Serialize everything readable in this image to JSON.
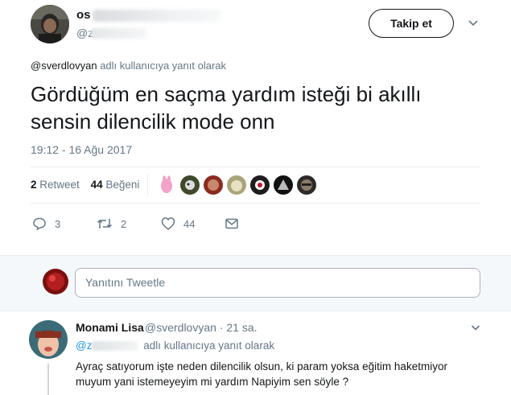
{
  "author": {
    "name_visible": "os",
    "handle_visible": "@z"
  },
  "follow_button": "Takip et",
  "reply_context": {
    "handle": "@sverdlovyan",
    "suffix": "adlı kullanıcıya yanıt olarak"
  },
  "tweet": {
    "text": "Gördüğüm en saçma yardım isteği bi akıllı sensin dilencilik mode onn",
    "timestamp": "19:12 - 16 Ağu 2017"
  },
  "stats": {
    "retweet_count": "2",
    "retweet_label": "Retweet",
    "like_count": "44",
    "like_label": "Beğeni"
  },
  "actions": {
    "reply_count": "3",
    "retweet_count": "2",
    "like_count": "44"
  },
  "composer": {
    "placeholder": "Yanıtını Tweetle"
  },
  "reply": {
    "name": "Monami Lisa",
    "handle": "@sverdlovyan",
    "separator": "·",
    "time": "21 sa.",
    "context_handle": "@z",
    "context_suffix": "adlı kullanıcıya yanıt olarak",
    "text": "Ayraç satıyorum işte neden dilencilik olsun, ki param yoksa eğitim haketmiyor muyum yani istemeyeyim mi yardım Napiyim sen söyle ?"
  },
  "colors": {
    "text": "#14171a",
    "muted": "#657786",
    "link": "#1b95e0",
    "divider": "#e6ecf0",
    "composer_bg": "#f5f8fa"
  },
  "icons": {
    "reply": "reply-icon",
    "retweet": "retweet-icon",
    "like": "heart-icon",
    "dm": "envelope-icon",
    "menu": "chevron-down-icon"
  }
}
